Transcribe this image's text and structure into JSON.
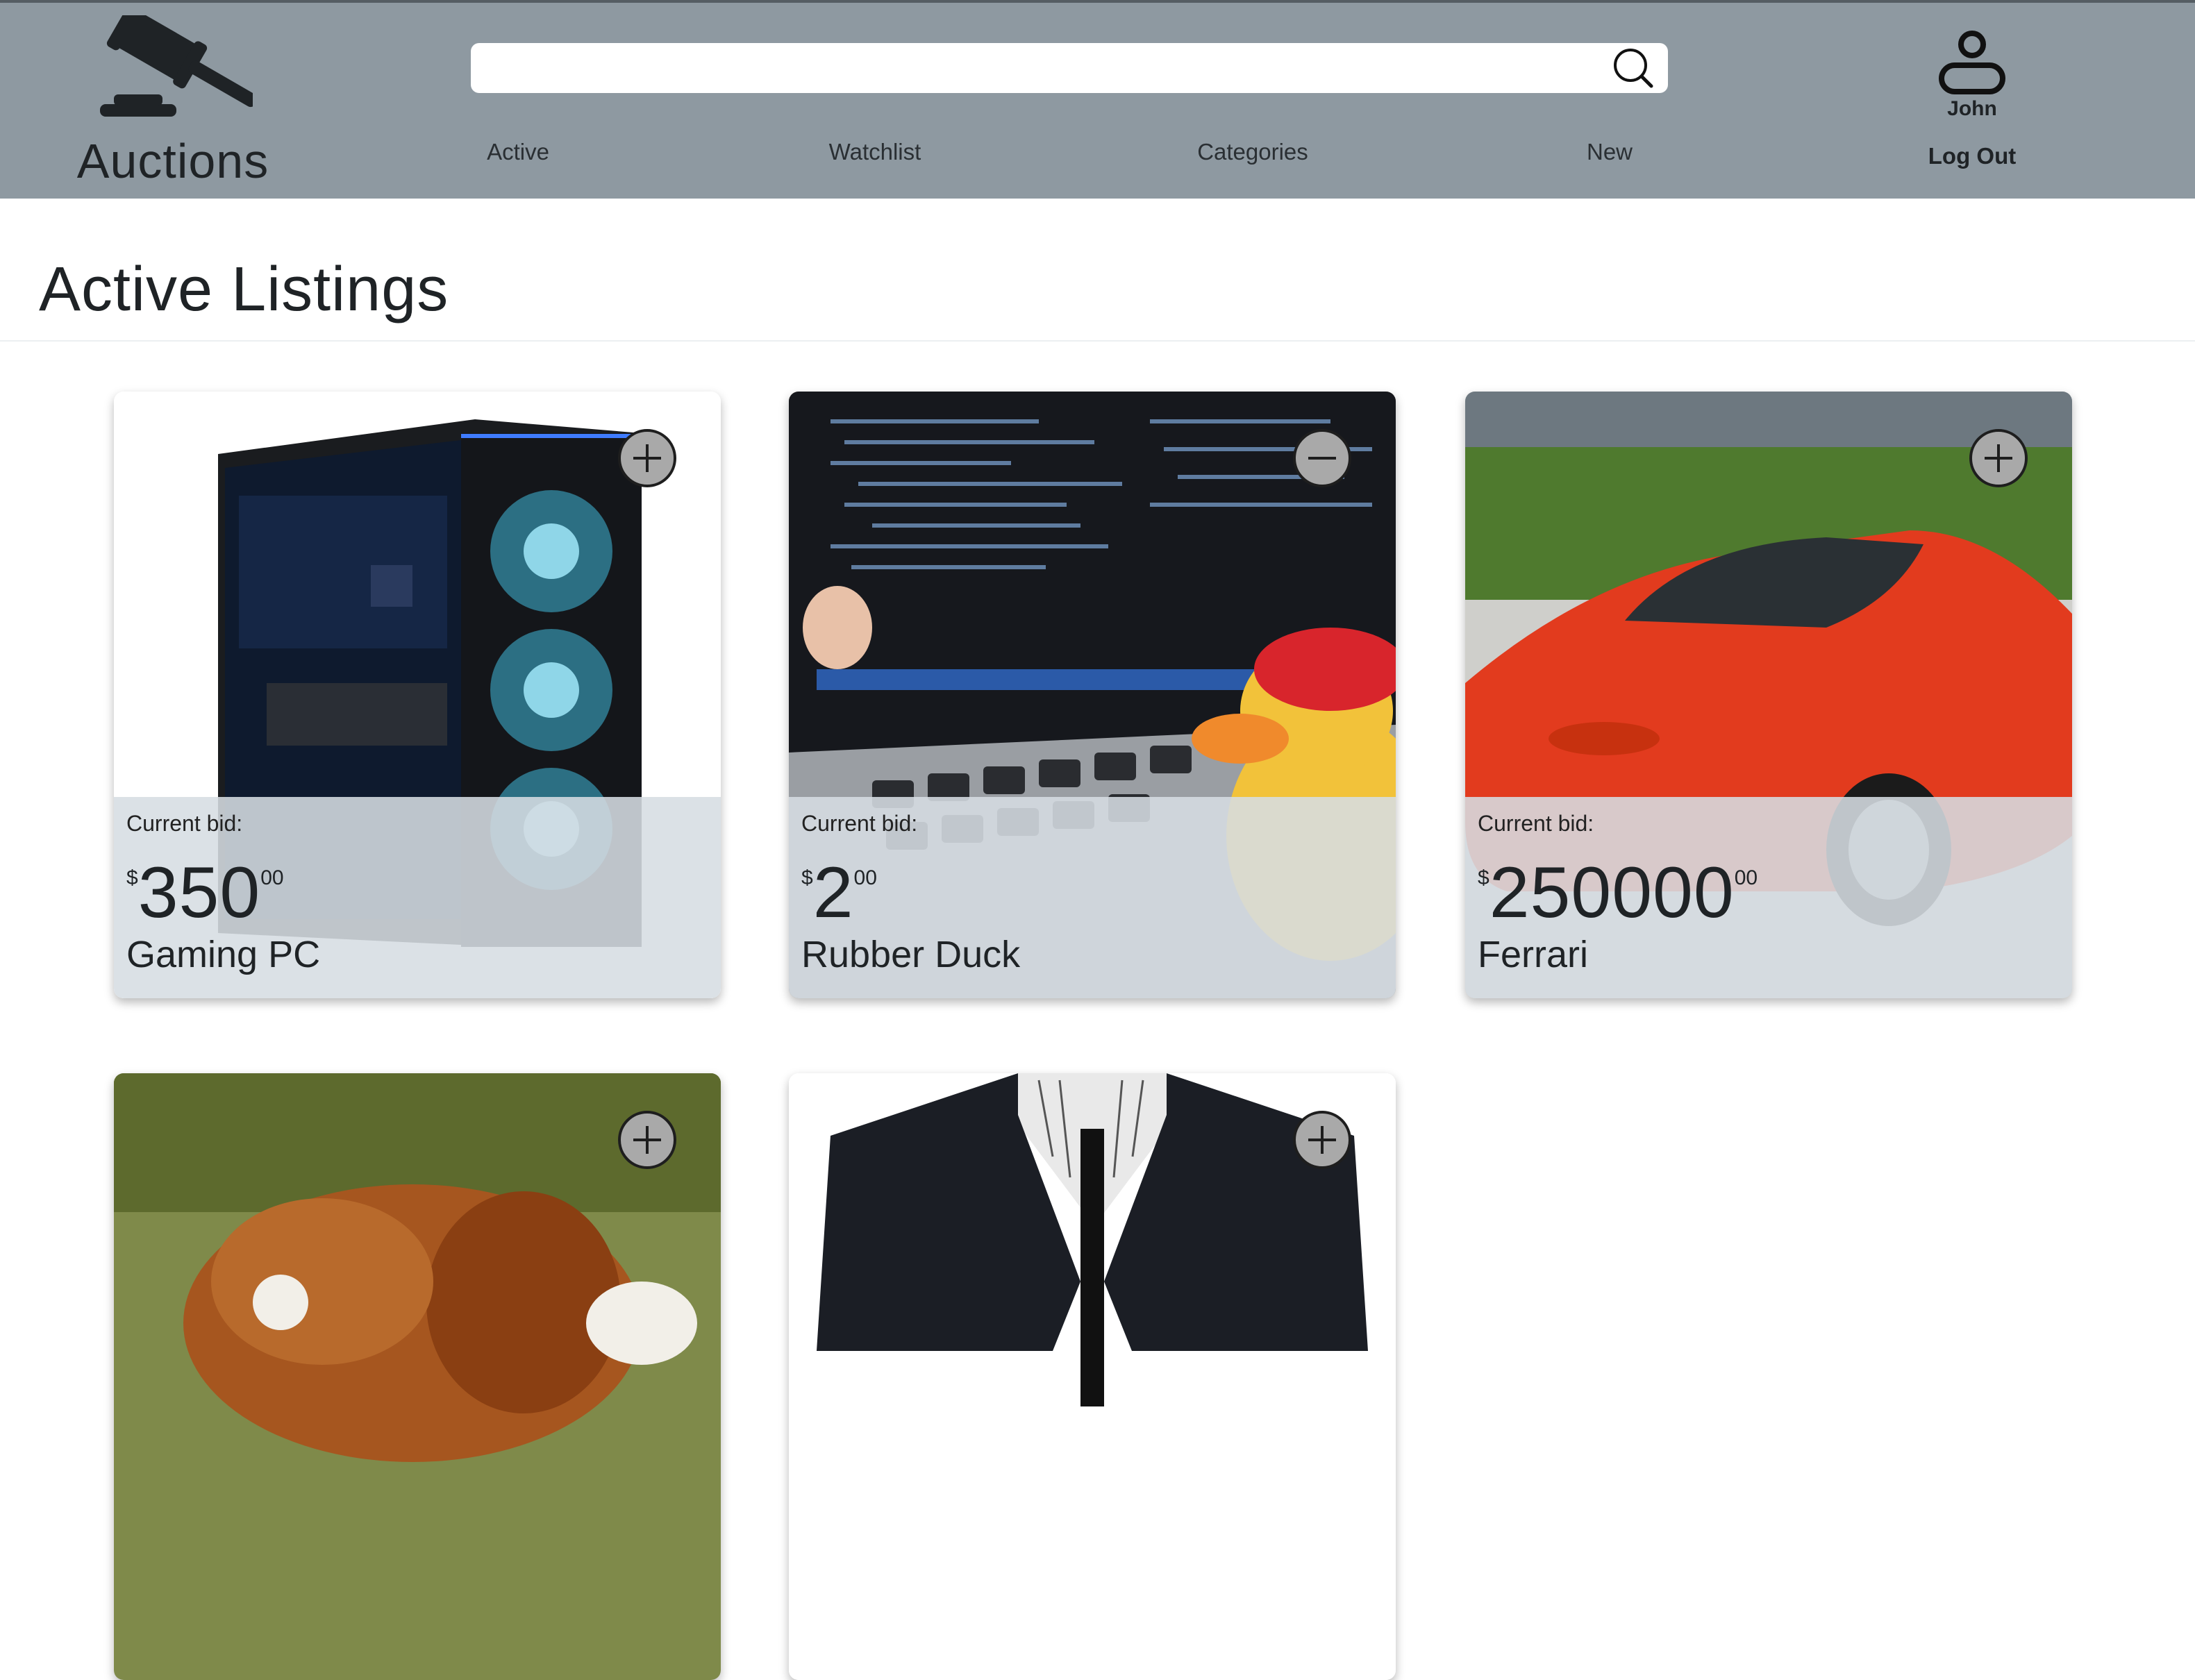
{
  "header": {
    "logo_text": "Auctions",
    "search": {
      "placeholder": "",
      "value": ""
    },
    "nav": [
      {
        "label": "Active"
      },
      {
        "label": "Watchlist"
      },
      {
        "label": "Categories"
      },
      {
        "label": "New"
      }
    ],
    "user": {
      "name": "John",
      "logout_label": "Log Out"
    }
  },
  "page": {
    "title": "Active Listings"
  },
  "listings": [
    {
      "bid_label": "Current bid:",
      "currency": "$",
      "amount": "350",
      "cents": "00",
      "name": "Gaming PC",
      "watch": "add"
    },
    {
      "bid_label": "Current bid:",
      "currency": "$",
      "amount": "2",
      "cents": "00",
      "name": "Rubber Duck",
      "watch": "remove"
    },
    {
      "bid_label": "Current bid:",
      "currency": "$",
      "amount": "250000",
      "cents": "00",
      "name": "Ferrari",
      "watch": "add"
    },
    {
      "name": "",
      "watch": "add"
    },
    {
      "name": "",
      "watch": "add"
    }
  ],
  "colors": {
    "header_bg": "#8e99a1",
    "overlay_bg": "#d6dde3",
    "text_dark": "#1f2326"
  }
}
